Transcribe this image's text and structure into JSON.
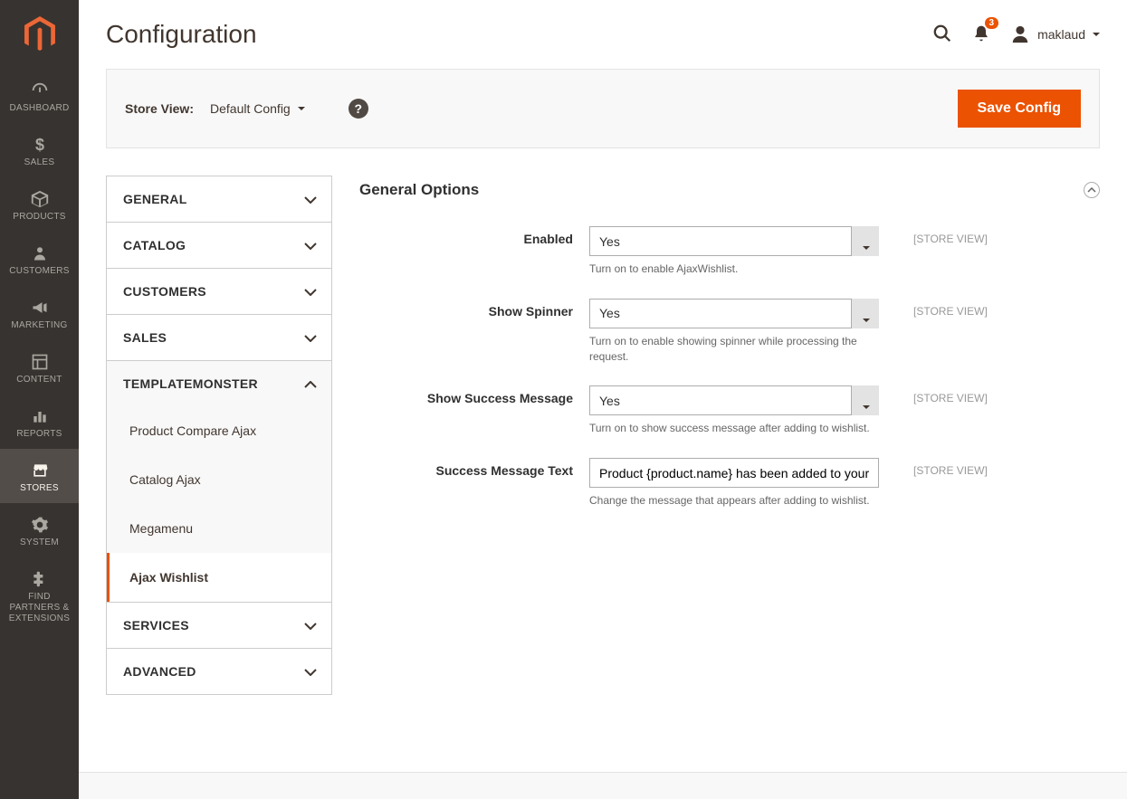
{
  "page": {
    "title": "Configuration"
  },
  "header": {
    "notifications_count": "3",
    "username": "maklaud"
  },
  "store_bar": {
    "label": "Store View:",
    "value": "Default Config",
    "save_button": "Save Config"
  },
  "sidebar": {
    "items": [
      {
        "key": "dashboard",
        "label": "DASHBOARD"
      },
      {
        "key": "sales",
        "label": "SALES"
      },
      {
        "key": "products",
        "label": "PRODUCTS"
      },
      {
        "key": "customers",
        "label": "CUSTOMERS"
      },
      {
        "key": "marketing",
        "label": "MARKETING"
      },
      {
        "key": "content",
        "label": "CONTENT"
      },
      {
        "key": "reports",
        "label": "REPORTS"
      },
      {
        "key": "stores",
        "label": "STORES"
      },
      {
        "key": "system",
        "label": "SYSTEM"
      },
      {
        "key": "partners",
        "label": "FIND PARTNERS & EXTENSIONS"
      }
    ]
  },
  "config_nav": {
    "sections": [
      {
        "label": "GENERAL",
        "expanded": false
      },
      {
        "label": "CATALOG",
        "expanded": false
      },
      {
        "label": "CUSTOMERS",
        "expanded": false
      },
      {
        "label": "SALES",
        "expanded": false
      },
      {
        "label": "TEMPLATEMONSTER",
        "expanded": true,
        "items": [
          {
            "label": "Product Compare Ajax",
            "active": false
          },
          {
            "label": "Catalog Ajax",
            "active": false
          },
          {
            "label": "Megamenu",
            "active": false
          },
          {
            "label": "Ajax Wishlist",
            "active": true
          }
        ]
      },
      {
        "label": "SERVICES",
        "expanded": false
      },
      {
        "label": "ADVANCED",
        "expanded": false
      }
    ]
  },
  "section": {
    "title": "General Options",
    "scope_label": "[STORE VIEW]",
    "fields": {
      "enabled": {
        "label": "Enabled",
        "value": "Yes",
        "hint": "Turn on to enable AjaxWishlist."
      },
      "spinner": {
        "label": "Show Spinner",
        "value": "Yes",
        "hint": "Turn on to enable showing spinner while processing the request."
      },
      "success": {
        "label": "Show Success Message",
        "value": "Yes",
        "hint": "Turn on to show success message after adding to wishlist."
      },
      "text": {
        "label": "Success Message Text",
        "value": "Product {product.name} has been added to your Wishlist",
        "hint": "Change the message that appears after adding to wishlist."
      }
    }
  }
}
